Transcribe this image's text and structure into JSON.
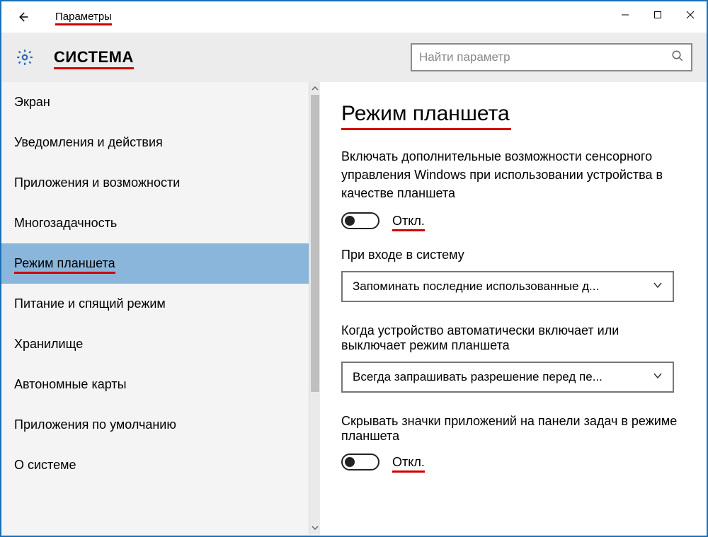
{
  "window": {
    "title": "Параметры",
    "category": "СИСТЕМА",
    "search_placeholder": "Найти параметр"
  },
  "sidebar": {
    "items": [
      {
        "label": "Экран"
      },
      {
        "label": "Уведомления и действия"
      },
      {
        "label": "Приложения и возможности"
      },
      {
        "label": "Многозадачность"
      },
      {
        "label": "Режим планшета",
        "selected": true
      },
      {
        "label": "Питание и спящий режим"
      },
      {
        "label": "Хранилище"
      },
      {
        "label": "Автономные карты"
      },
      {
        "label": "Приложения по умолчанию"
      },
      {
        "label": "О системе"
      }
    ]
  },
  "page": {
    "title": "Режим планшета",
    "toggle1": {
      "description": "Включать дополнительные возможности сенсорного управления Windows при использовании устройства в качестве планшета",
      "state": "Откл."
    },
    "setting1": {
      "label": "При входе в систему",
      "value": "Запоминать последние использованные д..."
    },
    "setting2": {
      "label": "Когда устройство автоматически включает или выключает режим планшета",
      "value": "Всегда запрашивать разрешение перед пе..."
    },
    "toggle2": {
      "description": "Скрывать значки приложений на панели задач в режиме планшета",
      "state": "Откл."
    }
  }
}
